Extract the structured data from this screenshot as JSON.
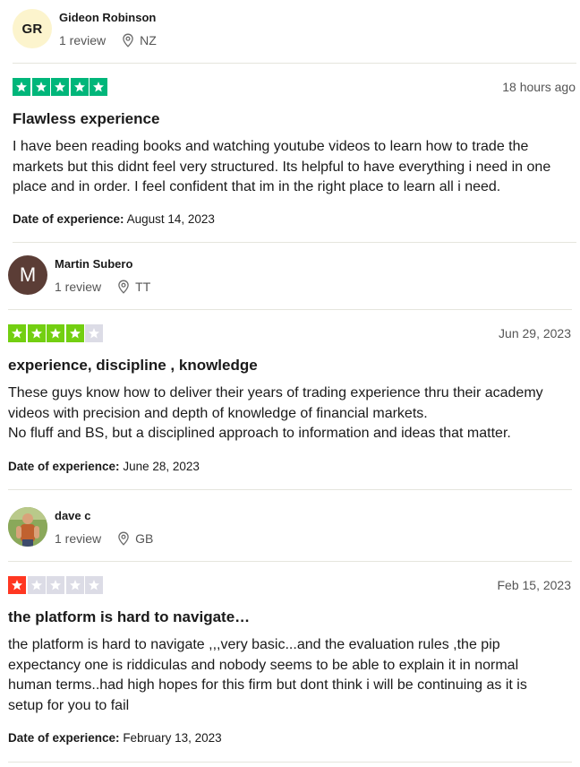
{
  "colors": {
    "star_5": "#00b67a",
    "star_4": "#73cf11",
    "star_1": "#ff3722",
    "star_empty": "#dcdce6"
  },
  "reviews": [
    {
      "consumer": {
        "name": "Gideon Robinson",
        "initials": "GR",
        "review_count": "1 review",
        "country": "NZ"
      },
      "rating": 5,
      "date": "18 hours ago",
      "title": "Flawless experience",
      "body": "I have been reading books and watching youtube videos to learn how to trade the markets but this didnt feel very structured. Its helpful to have everything i need in one place and in order. I feel confident that im in the right place to learn all i need.",
      "experience_label": "Date of experience:",
      "experience_date": "August 14, 2023"
    },
    {
      "consumer": {
        "name": "Martin Subero",
        "initials": "M",
        "review_count": "1 review",
        "country": "TT"
      },
      "rating": 4,
      "date": "Jun 29, 2023",
      "title": "experience, discipline , knowledge",
      "body": "These guys know how to deliver their years of trading experience thru their academy videos with precision and depth of knowledge of financial markets.\nNo fluff and BS, but a disciplined approach to information and ideas that matter.",
      "experience_label": "Date of experience:",
      "experience_date": "June 28, 2023"
    },
    {
      "consumer": {
        "name": "dave c",
        "review_count": "1 review",
        "country": "GB"
      },
      "rating": 1,
      "date": "Feb 15, 2023",
      "title": "the platform is hard to navigate…",
      "body": "the platform is hard to navigate ,,,very basic...and the evaluation rules ,the pip expectancy one is riddiculas and nobody seems to be able to explain it in normal human terms..had high hopes for this firm but dont think i will be continuing as it is setup for you to fail",
      "experience_label": "Date of experience:",
      "experience_date": "February 13, 2023"
    }
  ]
}
